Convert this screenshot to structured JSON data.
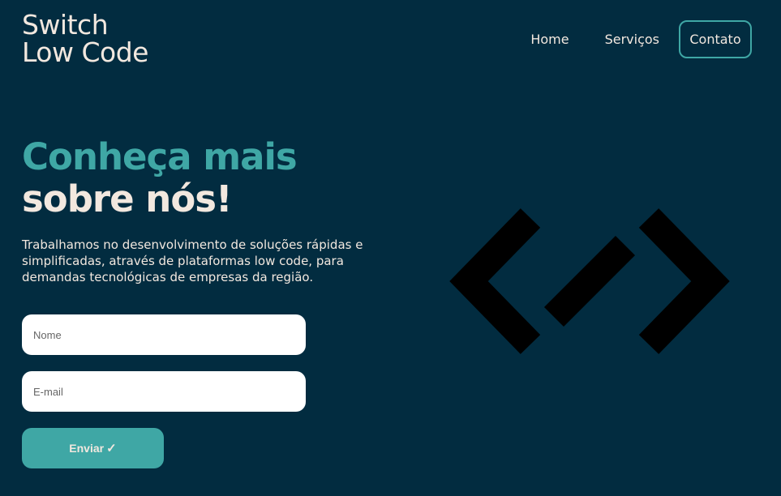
{
  "header": {
    "logo_line1": "Switch",
    "logo_line2": "Low Code",
    "nav": {
      "home": "Home",
      "services": "Serviços",
      "contact": "Contato"
    }
  },
  "hero": {
    "title_line1": "Conheça mais",
    "title_line2": "sobre nós!",
    "description": "Trabalhamos no desenvolvimento de soluções rápidas e simplificadas, através de plataformas low code, para demandas tecnológicas de empresas da região."
  },
  "form": {
    "name_placeholder": "Nome",
    "name_value": "",
    "email_placeholder": "E-mail",
    "email_value": "",
    "submit_label": "Enviar",
    "submit_icon": "check-icon"
  },
  "illustration": {
    "icon": "code-brackets-icon"
  },
  "colors": {
    "background": "#022c40",
    "accent": "#3fa7a5",
    "text_light": "#f2e8df",
    "graphic": "#000000"
  }
}
